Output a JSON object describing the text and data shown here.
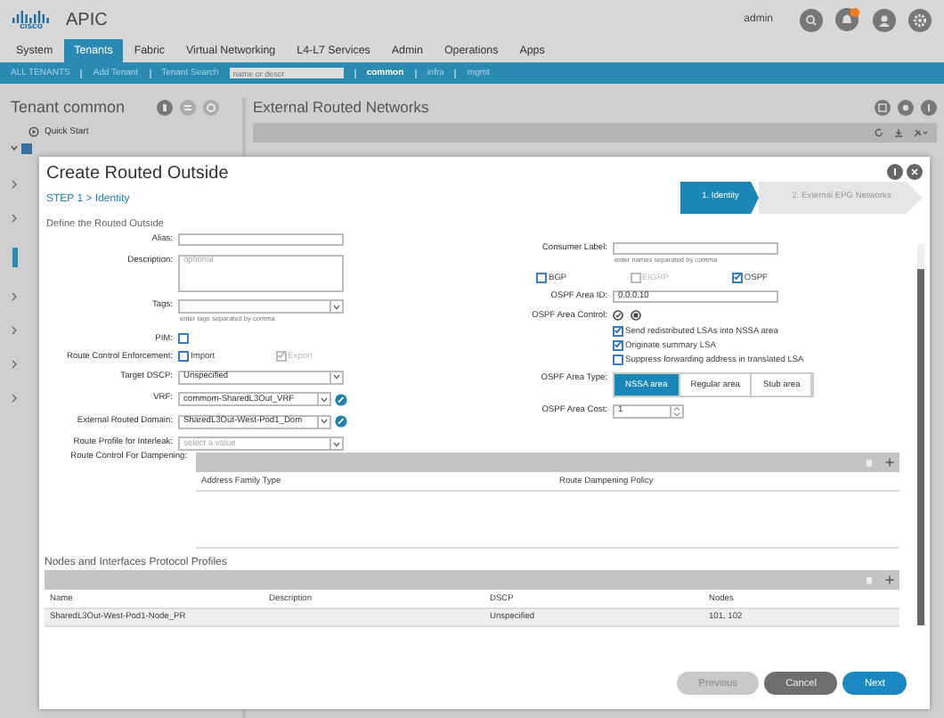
{
  "header": {
    "logo": "cisco",
    "app": "APIC",
    "user": "admin"
  },
  "nav_tabs": [
    {
      "label": "System",
      "selected": false
    },
    {
      "label": "Tenants",
      "selected": true
    },
    {
      "label": "Fabric",
      "selected": false
    },
    {
      "label": "Virtual Networking",
      "selected": false
    },
    {
      "label": "L4-L7 Services",
      "selected": false
    },
    {
      "label": "Admin",
      "selected": false
    },
    {
      "label": "Operations",
      "selected": false
    },
    {
      "label": "Apps",
      "selected": false
    }
  ],
  "tenant_bar": {
    "links": [
      "ALL TENANTS",
      "Add Tenant"
    ],
    "search_label": "Tenant Search",
    "search_placeholder": "name or descr",
    "tenants": [
      {
        "label": "common",
        "selected": true
      },
      {
        "label": "infra",
        "selected": false
      },
      {
        "label": "mgmt",
        "selected": false
      }
    ]
  },
  "left_panel": {
    "title": "Tenant common",
    "quick_start": "Quick Start"
  },
  "main_panel": {
    "title": "External Routed Networks"
  },
  "dialog": {
    "title": "Create Routed Outside",
    "step": "STEP 1 > Identity",
    "wizard_steps": [
      {
        "label": "1. Identity",
        "selected": true
      },
      {
        "label": "2. External EPG Networks",
        "selected": false
      }
    ],
    "section": "Define the Routed Outside",
    "left_fields": [
      {
        "kind": "text",
        "label": "Alias:"
      },
      {
        "kind": "textarea",
        "label": "Description:",
        "placeholder": "optional"
      },
      {
        "kind": "select",
        "label": "Tags:",
        "hint": "enter tags separated by comma"
      },
      {
        "kind": "checks",
        "label": "PIM:",
        "options": [
          {
            "checked": false,
            "disabled": false
          }
        ]
      },
      {
        "kind": "checks",
        "label": "Route Control Enforcement:",
        "options": [
          {
            "label": "Import",
            "checked": false,
            "disabled": false
          },
          {
            "label": "Export",
            "checked": true,
            "disabled": true
          }
        ]
      },
      {
        "kind": "select",
        "label": "Target DSCP:",
        "value": "Unspecified"
      },
      {
        "kind": "select",
        "label": "VRF:",
        "value": "commom-SharedL3Out_VRF",
        "link": true
      },
      {
        "kind": "select",
        "label": "External Routed Domain:",
        "value": "SharedL3Out-West-Pod1_Dom",
        "link": true
      },
      {
        "kind": "select",
        "label": "Route Profile for Interleak:",
        "placeholder": "select a value"
      }
    ],
    "right_fields": [
      {
        "kind": "text",
        "label": "Consumer Label:",
        "hint": "enter names separated by comma"
      },
      {
        "kind": "spread",
        "options": [
          {
            "label": "BGP",
            "checked": false,
            "disabled": false
          },
          {
            "label": "EIGRP",
            "checked": false,
            "disabled": true
          },
          {
            "label": "OSPF",
            "checked": true,
            "disabled": false
          }
        ]
      },
      {
        "kind": "text",
        "label": "OSPF Area ID:",
        "value": "0.0.0.10"
      },
      {
        "kind": "checklist",
        "label": "OSPF Area Control:",
        "options": [
          {
            "label": "Send redistributed LSAs into NSSA area",
            "checked": true,
            "disabled": false
          },
          {
            "label": "Originate summary LSA",
            "checked": true,
            "disabled": false
          },
          {
            "label": "Suppress forwarding address in translated LSA",
            "checked": false,
            "disabled": false
          }
        ]
      },
      {
        "kind": "segmented",
        "label": "OSPF Area Type:",
        "options": [
          {
            "label": "NSSA area",
            "selected": true
          },
          {
            "label": "Regular area",
            "selected": false
          },
          {
            "label": "Stub area",
            "selected": false
          }
        ]
      },
      {
        "kind": "spinner",
        "label": "OSPF Area Cost:",
        "value": "1"
      }
    ],
    "dampening": {
      "label": "Route Control For Dampening:",
      "columns": [
        "Address Family Type",
        "Route Dampening Policy"
      ]
    },
    "profiles": {
      "title": "Nodes and Interfaces Protocol Profiles",
      "columns": [
        "Name",
        "Description",
        "DSCP",
        "Nodes"
      ],
      "rows": [
        [
          "SharedL3Out-West-Pod1-Node_PR",
          "",
          "Unspecified",
          "101, 102"
        ]
      ]
    },
    "buttons": [
      {
        "label": "Previous",
        "kind": "disabled"
      },
      {
        "label": "Cancel",
        "kind": "secondary"
      },
      {
        "label": "Next",
        "kind": "primary"
      }
    ]
  }
}
